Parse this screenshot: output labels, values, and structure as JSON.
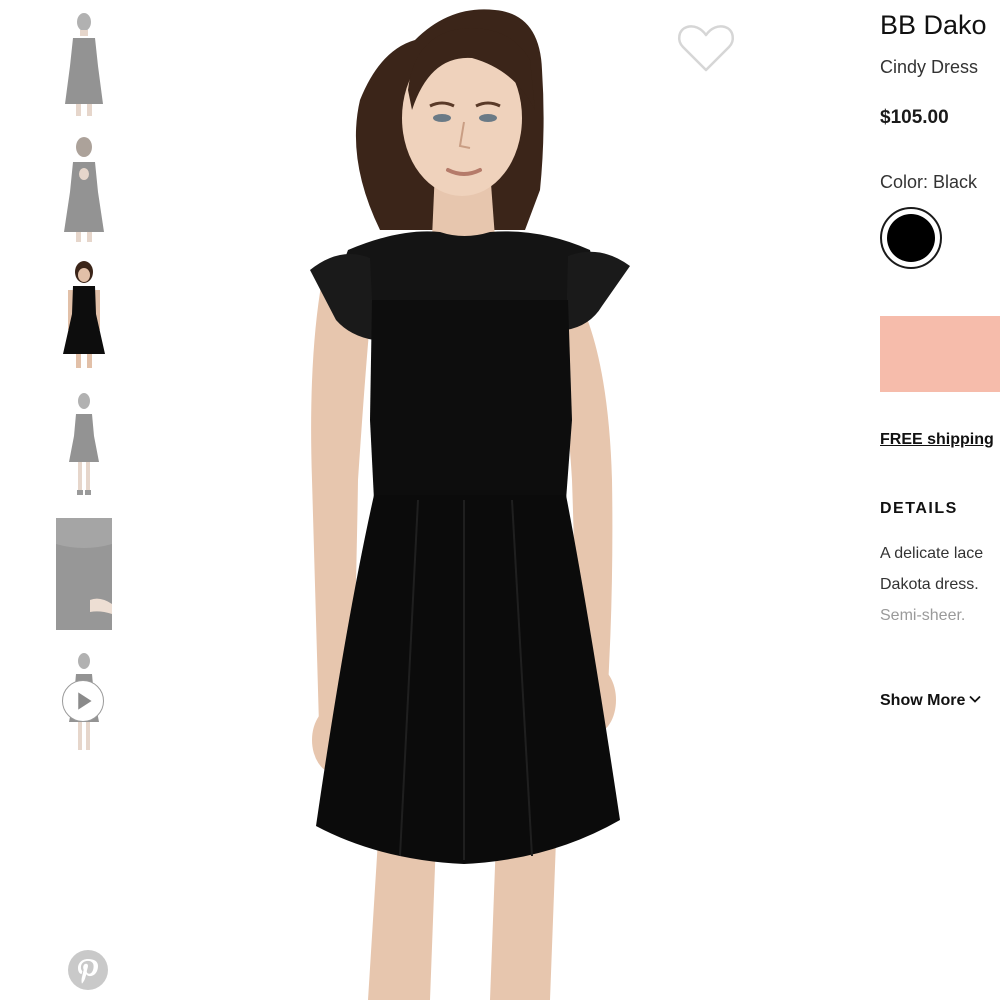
{
  "product": {
    "brand_title": "BB Dako",
    "subtitle": "Cindy Dress",
    "price": "$105.00",
    "color_label": "Color: Black",
    "selected_color": "#000000"
  },
  "actions": {
    "add_button_color": "#f6bcab",
    "shipping_link": "FREE shipping"
  },
  "details": {
    "heading": "DETAILS",
    "lines": [
      "A delicate lace",
      "Dakota dress.",
      "Semi-sheer."
    ],
    "show_more": "Show More"
  },
  "gallery": {
    "thumbnails": [
      {
        "view": "front",
        "active": false
      },
      {
        "view": "back",
        "active": false
      },
      {
        "view": "model-front",
        "active": true
      },
      {
        "view": "full-length",
        "active": false
      },
      {
        "view": "detail",
        "active": false
      },
      {
        "view": "video",
        "active": false
      }
    ],
    "icons": [
      "heart-icon",
      "play-icon",
      "pinterest-icon",
      "chevron-down-icon"
    ]
  }
}
